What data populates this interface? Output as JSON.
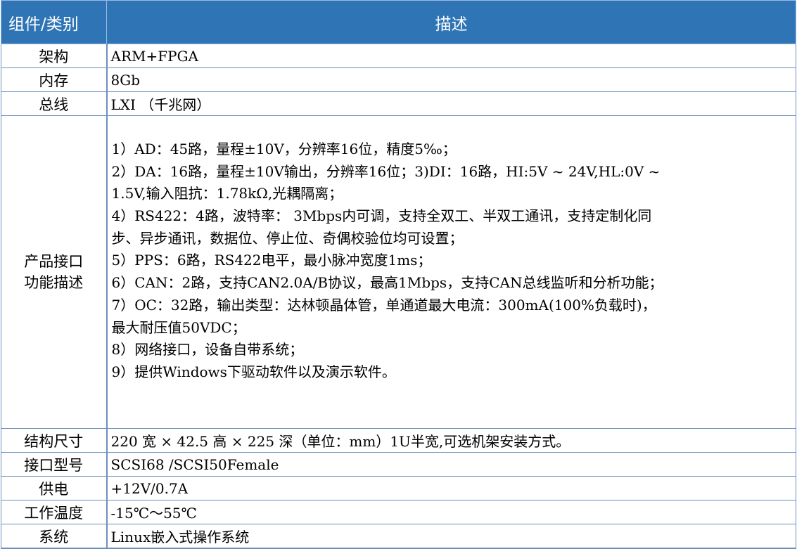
{
  "header": {
    "col1": "组件/类别",
    "col2": "描述"
  },
  "rows": [
    {
      "label": "架构",
      "value": "ARM+FPGA"
    },
    {
      "label": "内存",
      "value": "8Gb"
    },
    {
      "label": "总线",
      "value": "LXI （千兆网）"
    }
  ],
  "features": {
    "label_line1": "产品接口",
    "label_line2": "功能描述",
    "lines": [
      "1）AD：45路，量程±10V，分辨率16位，精度5‰；",
      "2）DA：16路，量程±10V输出，分辨率16位；3)DI：16路，HI:5V ~ 24V,HL:0V ~",
      "1.5V,输入阻抗：1.78kΩ,光耦隔离；",
      "4）RS422：4路，波特率： 3Mbps内可调，支持全双工、半双工通讯，支持定制化同",
      "步、异步通讯，数据位、停止位、奇偶校验位均可设置；",
      "5）PPS：6路，RS422电平，最小脉冲宽度1ms；",
      "6）CAN：2路，支持CAN2.0A/B协议，最高1Mbps，支持CAN总线监听和分析功能；",
      "7）OC：32路，输出类型：达林顿晶体管，单通道最大电流：300mA(100%负载时)，",
      "最大耐压值50VDC；",
      "8）网络接口，设备自带系统；",
      "9）提供Windows下驱动软件以及演示软件。"
    ]
  },
  "rows_after": [
    {
      "label": "结构尺寸",
      "value": "220 宽 × 42.5 高 × 225 深（单位：mm）1U半宽,可选机架安装方式。"
    },
    {
      "label": "接口型号",
      "value": "SCSI68 /SCSI50Female"
    },
    {
      "label": "供电",
      "value": "+12V/0.7A"
    },
    {
      "label": "工作温度",
      "value": "-15℃～55℃"
    },
    {
      "label": "系统",
      "value": "Linux嵌入式操作系统"
    }
  ],
  "colors": {
    "header_bg": "#2f74b5",
    "header_text": "#ffffff",
    "border": "#6c8fbd"
  }
}
